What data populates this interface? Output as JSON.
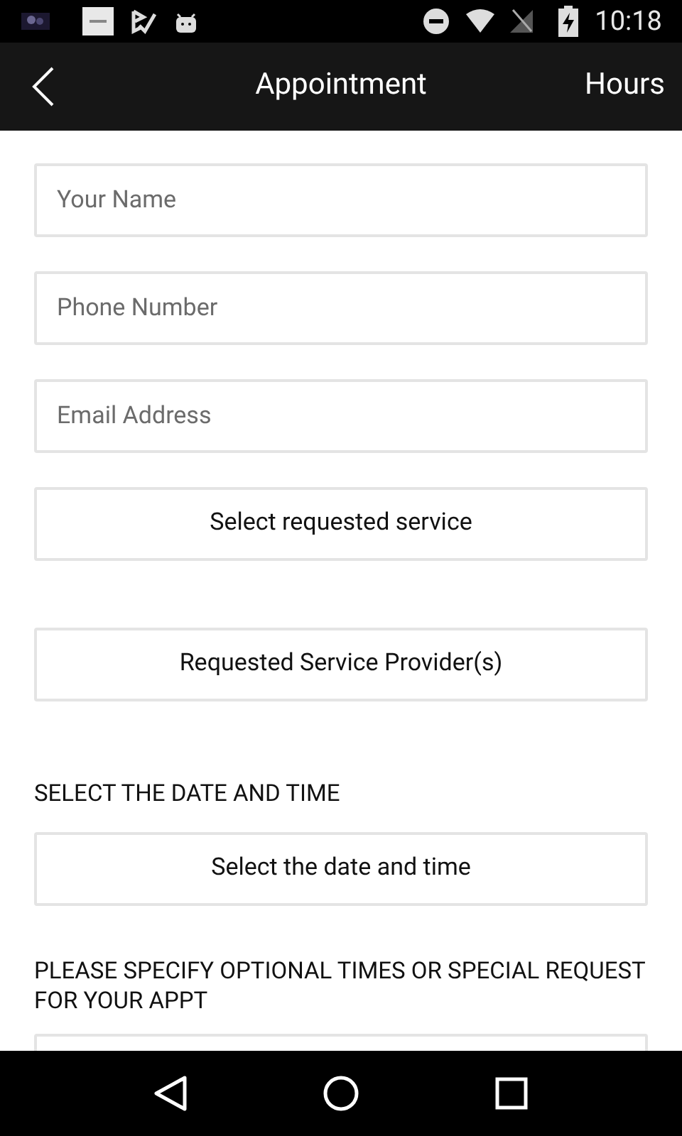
{
  "status_bar": {
    "time": "10:18"
  },
  "app_bar": {
    "title": "Appointment",
    "action": "Hours"
  },
  "form": [
    {
      "kind": "input",
      "placeholder": "Your Name"
    },
    {
      "kind": "input",
      "placeholder": "Phone Number"
    },
    {
      "kind": "input",
      "placeholder": "Email Address"
    },
    {
      "kind": "button",
      "label": "Select requested service"
    },
    {
      "kind": "button",
      "label": "Requested Service Provider(s)"
    },
    {
      "kind": "section",
      "text": "SELECT THE DATE AND TIME"
    },
    {
      "kind": "button",
      "label": "Select the date and time"
    },
    {
      "kind": "section",
      "text": "PLEASE SPECIFY OPTIONAL TIMES OR SPECIAL REQUEST FOR YOUR APPT"
    },
    {
      "kind": "textarea"
    }
  ]
}
